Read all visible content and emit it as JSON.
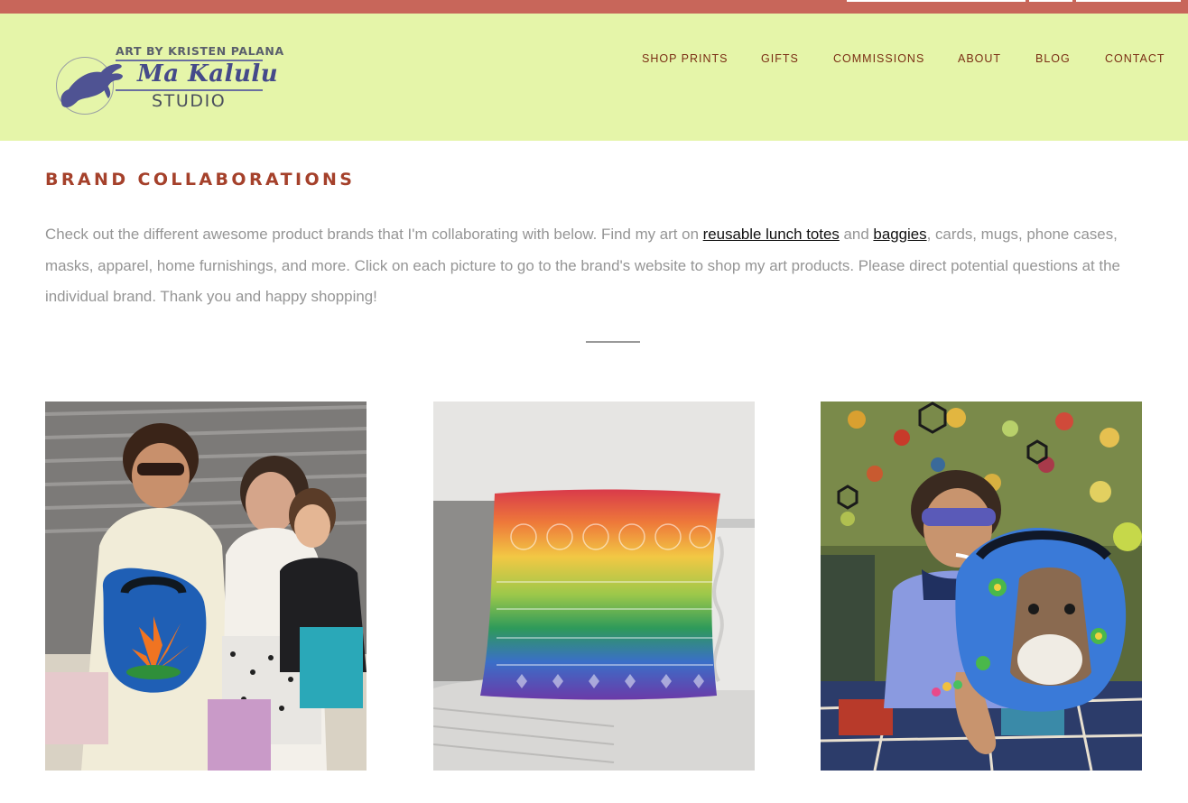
{
  "logo": {
    "top_text": "ART BY KRISTEN PALANA",
    "name": "Ma Kalulu",
    "studio": "STUDIO",
    "icon": "rabbit-icon"
  },
  "nav": {
    "items": [
      {
        "label": "SHOP PRINTS"
      },
      {
        "label": "GIFTS"
      },
      {
        "label": "COMMISSIONS"
      },
      {
        "label": "ABOUT"
      },
      {
        "label": "BLOG"
      },
      {
        "label": "CONTACT"
      }
    ]
  },
  "main": {
    "title": "BRAND COLLABORATIONS",
    "intro": {
      "part1": "Check out the different awesome product brands that I'm collaborating with below. Find my art on ",
      "link1": "reusable lunch totes",
      "part2": " and ",
      "link2": "baggies",
      "part3": ", cards, mugs, phone cases, masks, apparel, home furnishings, and more. Click on each picture to go to the brand's website to shop my art products. Please direct potential questions at the individual brand. Thank you and happy shopping!"
    }
  },
  "colors": {
    "top_bar": "#c8665a",
    "header_bg": "#e5f5a9",
    "nav_text": "#7a2e14",
    "title": "#a5412b",
    "body_text": "#959595",
    "logo_purple": "#454a8a"
  },
  "gallery": [
    {
      "image": "photo-lunch-tote-lotus"
    },
    {
      "image": "photo-rainbow-pillow"
    },
    {
      "image": "photo-donkey-lunch-tote"
    }
  ]
}
